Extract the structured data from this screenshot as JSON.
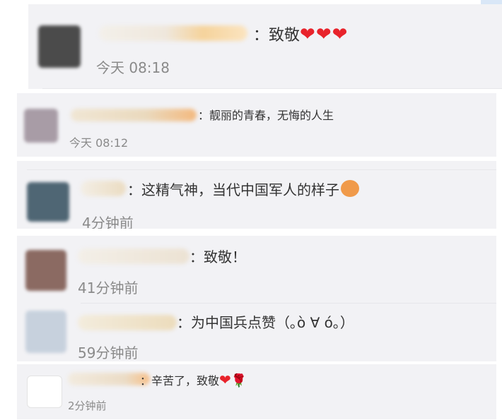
{
  "comments": [
    {
      "text": "致敬",
      "hearts": "❤❤❤",
      "time": "今天 08:18"
    },
    {
      "text": "靓丽的青春，无悔的人生",
      "time": "今天 08:12"
    },
    {
      "text": "这精气神，当代中国军人的样子",
      "time": "4分钟前"
    },
    {
      "text": "致敬！",
      "time": "41分钟前"
    },
    {
      "text": "为中国兵点赞（｡ò ∀ ó｡）",
      "time": "59分钟前"
    },
    {
      "text": "辛苦了，致敬",
      "hearts": "❤",
      "rose": "🌹",
      "time": "2分钟前"
    }
  ],
  "colon": "："
}
